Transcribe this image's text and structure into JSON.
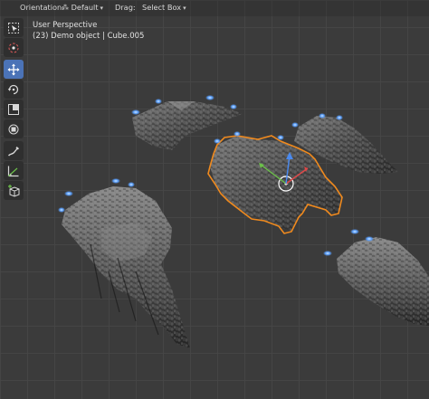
{
  "header": {
    "orientation_label": "Orientation:",
    "orientation_value": "Default",
    "drag_label": "Drag:",
    "drag_value": "Select Box"
  },
  "viewport_info": {
    "perspective": "User Perspective",
    "object": "(23) Demo object | Cube.005"
  },
  "toolbar": {
    "tools": [
      {
        "name": "select-box",
        "icon": "select-box-icon",
        "active": false
      },
      {
        "name": "cursor",
        "icon": "cursor-icon",
        "active": false
      },
      {
        "name": "move",
        "icon": "move-icon",
        "active": true
      },
      {
        "name": "rotate",
        "icon": "rotate-icon",
        "active": false
      },
      {
        "name": "scale",
        "icon": "scale-icon",
        "active": false
      },
      {
        "name": "transform",
        "icon": "transform-icon",
        "active": false
      },
      {
        "name": "annotate",
        "icon": "annotate-icon",
        "active": false
      },
      {
        "name": "measure",
        "icon": "measure-icon",
        "active": false
      },
      {
        "name": "add-cube",
        "icon": "add-cube-icon",
        "active": false
      }
    ]
  },
  "colors": {
    "viewport_bg": "#3b3b3b",
    "active_tool": "#4b73b7",
    "selection_outline": "#f08a1e",
    "engine_glow": "#5aa0ff"
  }
}
